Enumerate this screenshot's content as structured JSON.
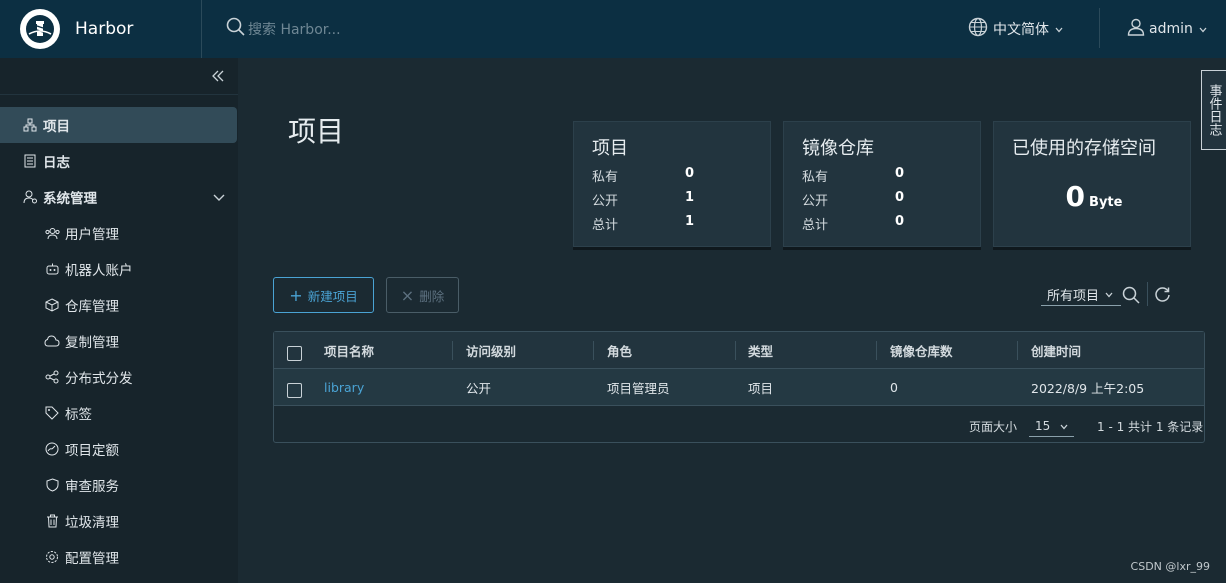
{
  "header": {
    "app_name": "Harbor",
    "search_placeholder": "搜索 Harbor...",
    "language": "中文简体",
    "user": "admin"
  },
  "sidebar": {
    "items": [
      {
        "label": "项目",
        "icon": "projects-icon"
      },
      {
        "label": "日志",
        "icon": "logs-icon"
      },
      {
        "label": "系统管理",
        "icon": "admin-icon"
      },
      {
        "label": "用户管理",
        "icon": "users-icon"
      },
      {
        "label": "机器人账户",
        "icon": "robot-icon"
      },
      {
        "label": "仓库管理",
        "icon": "registry-icon"
      },
      {
        "label": "复制管理",
        "icon": "replication-icon"
      },
      {
        "label": "分布式分发",
        "icon": "distribution-icon"
      },
      {
        "label": "标签",
        "icon": "tag-icon"
      },
      {
        "label": "项目定额",
        "icon": "quota-icon"
      },
      {
        "label": "审查服务",
        "icon": "shield-icon"
      },
      {
        "label": "垃圾清理",
        "icon": "trash-icon"
      },
      {
        "label": "配置管理",
        "icon": "settings-icon"
      }
    ]
  },
  "main": {
    "title": "项目",
    "cards": {
      "projects": {
        "title": "项目",
        "private_label": "私有",
        "private": "0",
        "public_label": "公开",
        "public": "1",
        "total_label": "总计",
        "total": "1"
      },
      "repos": {
        "title": "镜像仓库",
        "private_label": "私有",
        "private": "0",
        "public_label": "公开",
        "public": "0",
        "total_label": "总计",
        "total": "0"
      },
      "storage": {
        "title": "已使用的存储空间",
        "value": "0",
        "unit": "Byte"
      }
    },
    "toolbar": {
      "new_project": "新建项目",
      "delete": "删除",
      "filter": "所有项目"
    },
    "table": {
      "columns": [
        "项目名称",
        "访问级别",
        "角色",
        "类型",
        "镜像仓库数",
        "创建时间"
      ],
      "rows": [
        {
          "name": "library",
          "access": "公开",
          "role": "项目管理员",
          "type": "项目",
          "repo_count": "0",
          "created": "2022/8/9 上午2:05"
        }
      ],
      "page_size_label": "页面大小",
      "page_size": "15",
      "pagination_info": "1 - 1 共计 1 条记录"
    },
    "side_tab": "事件日志"
  },
  "watermark": "CSDN @lxr_99",
  "colors": {
    "accent": "#4aa3d4",
    "header_bg": "#0c2f42",
    "sidebar_bg": "#17242b",
    "main_bg": "#1b2a32"
  }
}
